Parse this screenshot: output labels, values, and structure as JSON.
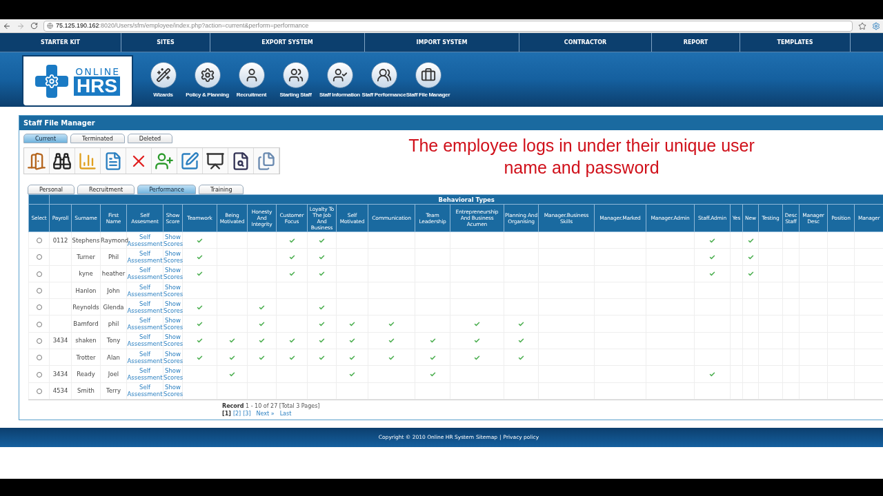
{
  "browser": {
    "url_host": "75.125.190.162",
    "url_rest": ":8020/Users/sfm/employee/index.php?action=current&perform=performance"
  },
  "nav": [
    "STARTER KIT",
    "SITES",
    "EXPORT SYSTEM",
    "IMPORT SYSTEM",
    "CONTRACTOR",
    "REPORT",
    "TEMPLATES"
  ],
  "logo": {
    "line1": "ONLINE",
    "line2": "HRS"
  },
  "modules": [
    {
      "label": "Wizards",
      "kind": "wizard"
    },
    {
      "label": "Policy & Planning",
      "kind": "gears"
    },
    {
      "label": "Recruitment",
      "kind": "person"
    },
    {
      "label": "Starting Staff",
      "kind": "people"
    },
    {
      "label": "Staff Information",
      "kind": "info"
    },
    {
      "label": "Staff Performance",
      "kind": "performance"
    },
    {
      "label": "Staff File Manager",
      "kind": "briefcase"
    }
  ],
  "panel": {
    "title": "Staff File Manager",
    "status_tabs": [
      {
        "label": "Current",
        "selected": true
      },
      {
        "label": "Terminated",
        "selected": false
      },
      {
        "label": "Deleted",
        "selected": false
      }
    ],
    "toolbar": [
      {
        "kind": "exit"
      },
      {
        "kind": "find"
      },
      {
        "kind": "report"
      },
      {
        "kind": "list"
      },
      {
        "kind": "delete"
      },
      {
        "kind": "add_user"
      },
      {
        "kind": "edit"
      },
      {
        "kind": "board"
      },
      {
        "kind": "search"
      },
      {
        "kind": "files"
      }
    ],
    "caption": "The employee logs in under their unique user name and password",
    "section_tabs": [
      {
        "label": "Personal",
        "selected": false
      },
      {
        "label": "Recruitment",
        "selected": false
      },
      {
        "label": "Performance",
        "selected": true
      },
      {
        "label": "Training",
        "selected": false
      }
    ],
    "table": {
      "group_header": "Behavioral Types",
      "columns": [
        "Select",
        "Payroll",
        "Surname",
        "First Name",
        "Self Assesment",
        "Show Score",
        "Teamwork",
        "Being Motivated",
        "Honesty And Integrity",
        "Customer Focus",
        "Loyalty To The Job And Business",
        "Self Motivated",
        "Communication",
        "Team Leadership",
        "Entrepreneurship And Business Acumen",
        "Planning And Organising",
        "Manager.Business Skills",
        "Manager.Marked",
        "Manager.Admin",
        "Staff.Admin",
        "Yes",
        "New",
        "Testing",
        "Desc Staff",
        "Manager Desc",
        "Position",
        "Manager"
      ],
      "rows": [
        {
          "selected": false,
          "payroll": "0112",
          "surname": "Stephens",
          "first_name": "Raymond",
          "assessment": "Self Assessment",
          "scores": "Show Scores",
          "marks": [
            true,
            false,
            false,
            true,
            true,
            false,
            false,
            false,
            false,
            false,
            false,
            false,
            false,
            true,
            false,
            true,
            false,
            false,
            false,
            false,
            false
          ]
        },
        {
          "selected": false,
          "surname": "Turner",
          "first_name": "Phil",
          "assessment": "Self Assessment",
          "scores": "Show Scores",
          "marks": [
            true,
            false,
            false,
            true,
            true,
            false,
            false,
            false,
            false,
            false,
            false,
            false,
            false,
            true,
            false,
            true,
            false,
            false,
            false,
            false,
            false
          ]
        },
        {
          "selected": false,
          "surname": "kyne",
          "first_name": "heather",
          "assessment": "Self Assessment",
          "scores": "Show Scores",
          "marks": [
            true,
            false,
            false,
            true,
            true,
            false,
            false,
            false,
            false,
            false,
            false,
            false,
            false,
            true,
            false,
            true,
            false,
            false,
            false,
            false,
            false
          ]
        },
        {
          "selected": false,
          "surname": "Hanlon",
          "first_name": "John",
          "assessment": "Self Assessment",
          "scores": "Show Scores",
          "marks": [
            false,
            false,
            false,
            false,
            false,
            false,
            false,
            false,
            false,
            false,
            false,
            false,
            false,
            false,
            false,
            false,
            false,
            false,
            false,
            false,
            false
          ]
        },
        {
          "selected": false,
          "surname": "Reynolds",
          "first_name": "Glenda",
          "assessment": "Self Assessment",
          "scores": "Show Scores",
          "marks": [
            true,
            false,
            true,
            false,
            true,
            false,
            false,
            false,
            false,
            false,
            false,
            false,
            false,
            false,
            false,
            false,
            false,
            false,
            false,
            false,
            false
          ]
        },
        {
          "selected": false,
          "surname": "Bamford",
          "first_name": "phil",
          "assessment": "Self Assessment",
          "scores": "Show Scores",
          "marks": [
            true,
            false,
            true,
            false,
            true,
            true,
            true,
            false,
            true,
            true,
            false,
            false,
            false,
            false,
            false,
            false,
            false,
            false,
            false,
            false,
            false
          ]
        },
        {
          "selected": false,
          "payroll": "3434",
          "surname": "shaken",
          "first_name": "Tony",
          "assessment": "Self Assessment",
          "scores": "Show Scores",
          "marks": [
            true,
            true,
            true,
            true,
            true,
            true,
            true,
            true,
            true,
            true,
            false,
            false,
            false,
            false,
            false,
            false,
            false,
            false,
            false,
            false,
            false
          ]
        },
        {
          "selected": false,
          "surname": "Trotter",
          "first_name": "Alan",
          "assessment": "Self Assessment",
          "scores": "Show Scores",
          "marks": [
            true,
            true,
            true,
            true,
            true,
            true,
            true,
            true,
            true,
            true,
            false,
            false,
            false,
            false,
            false,
            false,
            false,
            false,
            false,
            false,
            false
          ]
        },
        {
          "selected": false,
          "payroll": "3434",
          "surname": "Ready",
          "first_name": "Joel",
          "assessment": "Self Assessment",
          "scores": "Show Scores",
          "marks": [
            false,
            true,
            false,
            false,
            false,
            true,
            false,
            true,
            false,
            false,
            false,
            false,
            false,
            true,
            false,
            false,
            false,
            false,
            false,
            false,
            false
          ]
        },
        {
          "selected": false,
          "payroll": "4534",
          "surname": "Smith",
          "first_name": "Terry",
          "assessment": "Self Assessment",
          "scores": "Show Scores",
          "marks": [
            false,
            false,
            false,
            false,
            false,
            false,
            false,
            false,
            false,
            false,
            false,
            false,
            false,
            false,
            false,
            false,
            false,
            false,
            false,
            false,
            false
          ]
        }
      ]
    },
    "pagination": {
      "label": "Record",
      "summary": "1 - 10 of 27 [Total 3 Pages]",
      "pages": [
        {
          "label": "[1]",
          "selected": true
        },
        {
          "label": "[2]",
          "selected": false
        },
        {
          "label": "[3]",
          "selected": false
        }
      ],
      "next": "Next »",
      "last": "Last"
    }
  },
  "footer": {
    "copyright": "Copyright © 2010 Online HR System",
    "links": [
      "Sitemap",
      "Privacy policy"
    ],
    "separator": "|"
  }
}
